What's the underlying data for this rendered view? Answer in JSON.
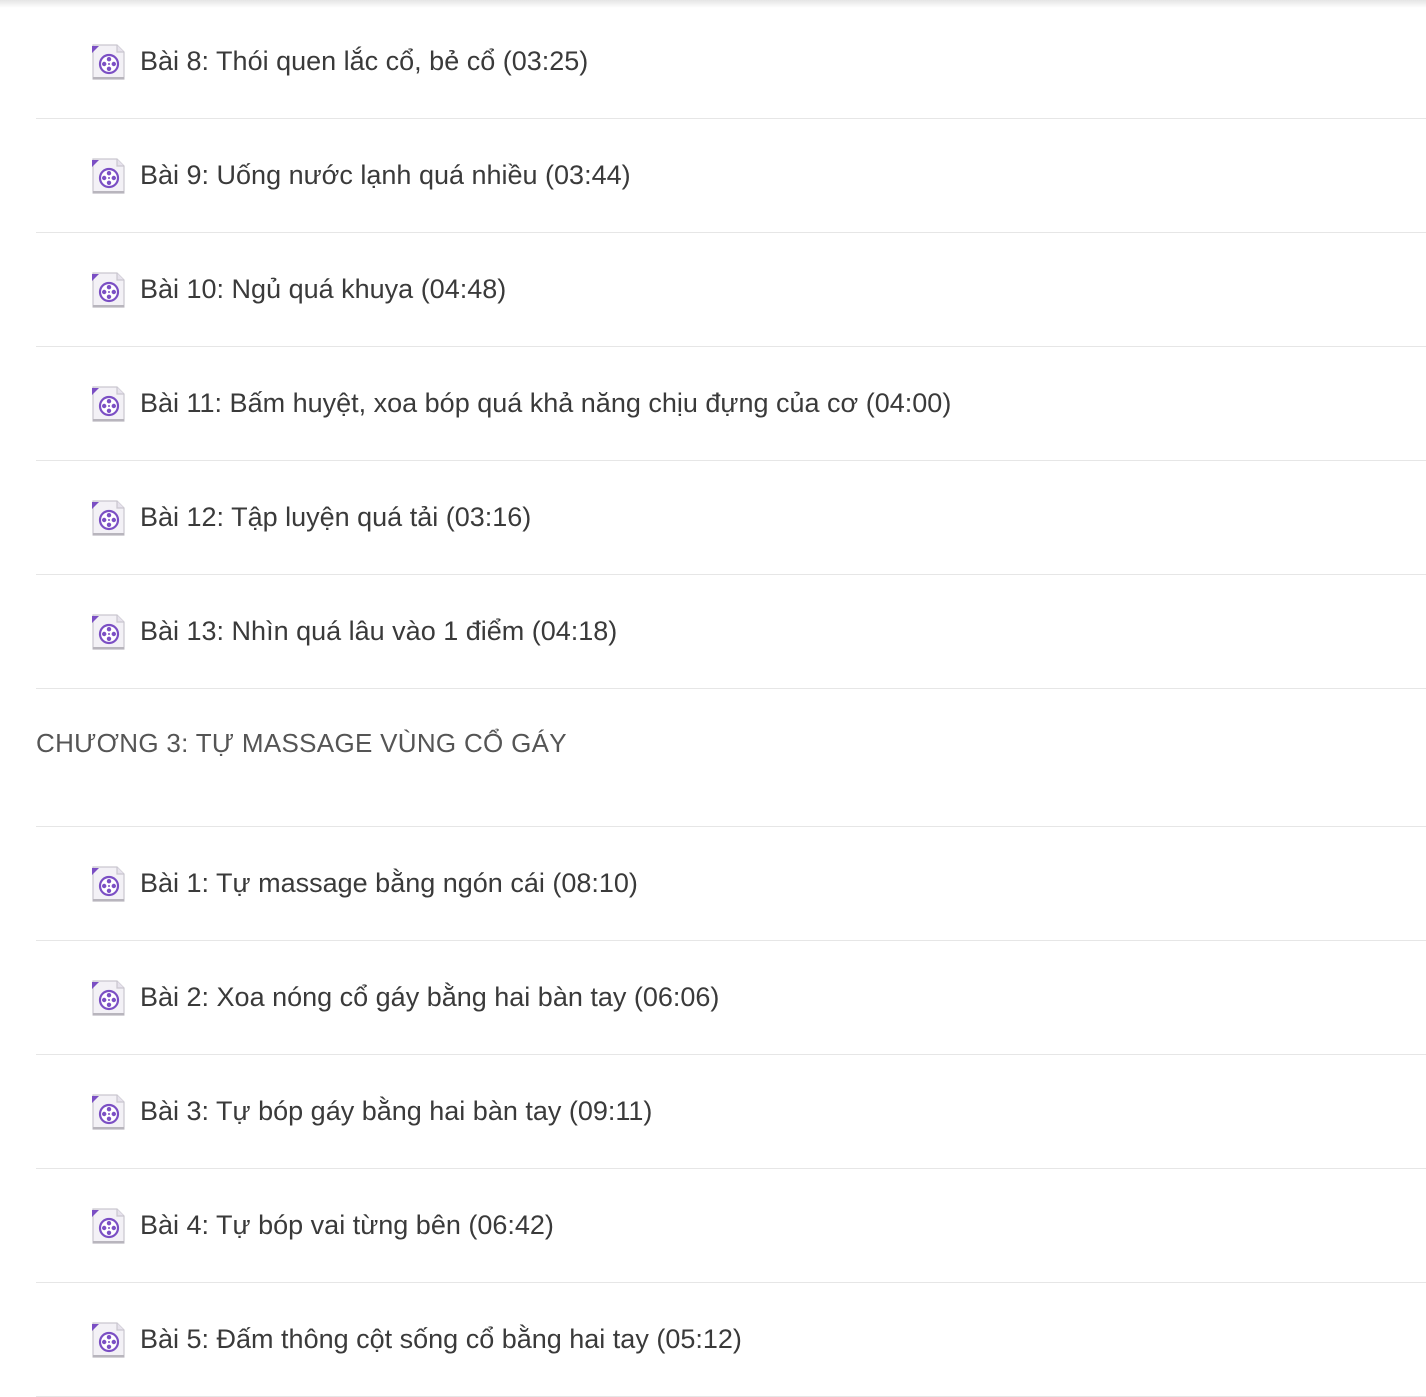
{
  "sections": [
    {
      "type": "lessons",
      "items": [
        {
          "label": "Bài 8: Thói quen lắc cổ, bẻ cổ (03:25)",
          "icon": "video-file-icon"
        },
        {
          "label": "Bài 9: Uống nước lạnh quá nhiều (03:44)",
          "icon": "video-file-icon"
        },
        {
          "label": "Bài 10: Ngủ quá khuya (04:48)",
          "icon": "video-file-icon"
        },
        {
          "label": "Bài 11: Bấm huyệt, xoa bóp quá khả năng chịu đựng của cơ (04:00)",
          "icon": "video-file-icon"
        },
        {
          "label": "Bài 12: Tập luyện quá tải (03:16)",
          "icon": "video-file-icon"
        },
        {
          "label": "Bài 13: Nhìn quá lâu vào 1 điểm (04:18)",
          "icon": "video-file-icon"
        }
      ]
    },
    {
      "type": "chapter",
      "title": "CHƯƠNG 3: TỰ MASSAGE VÙNG CỔ GÁY",
      "items": [
        {
          "label": "Bài 1: Tự massage bằng ngón cái (08:10)",
          "icon": "video-file-icon"
        },
        {
          "label": "Bài 2: Xoa nóng cổ gáy bằng hai bàn tay (06:06)",
          "icon": "video-file-icon"
        },
        {
          "label": "Bài 3: Tự bóp gáy bằng hai bàn tay (09:11)",
          "icon": "video-file-icon"
        },
        {
          "label": "Bài 4: Tự bóp vai từng bên (06:42)",
          "icon": "video-file-icon"
        },
        {
          "label": "Bài 5: Đấm thông cột sống cổ bằng hai tay (05:12)",
          "icon": "video-file-icon"
        }
      ]
    }
  ],
  "colors": {
    "icon_purple": "#7b4fc4",
    "divider": "#e6e6e6",
    "text": "#3a3a3a"
  }
}
